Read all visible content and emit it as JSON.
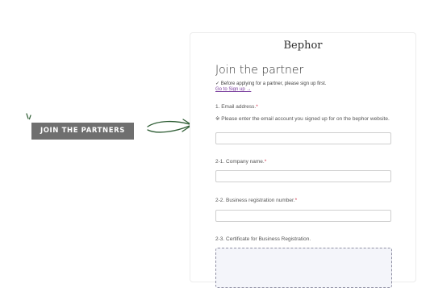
{
  "cta": {
    "button_label": "JOIN THE PARTNERS"
  },
  "form": {
    "logo_text": "Bephor",
    "title": "Join the partner",
    "note": "✓ Before applying for a partner, please sign up first.",
    "signup_link": "Go to Sign up →",
    "required_mark": "*",
    "fields": [
      {
        "label": "1. Email address.",
        "help": "※ Please enter the email account you signed up for on the bephor website.",
        "value": ""
      },
      {
        "label": "2-1. Company name.",
        "value": ""
      },
      {
        "label": "2-2. Business registration number.",
        "value": ""
      },
      {
        "label": "2-3. Certificate for Business Registration."
      }
    ]
  }
}
